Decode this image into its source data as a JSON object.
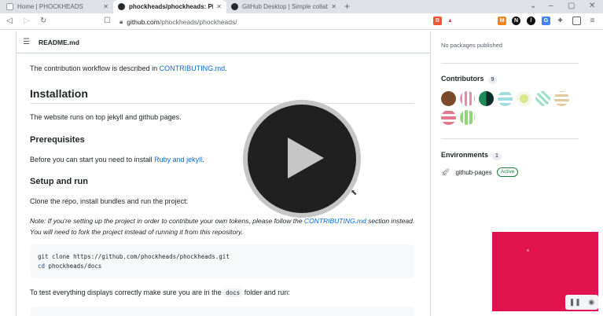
{
  "browser": {
    "tabs": [
      {
        "title": "Home | PHOCKHEADS",
        "close": "✕",
        "active": false
      },
      {
        "title": "phockheads/phockheads: Phockh",
        "close": "✕",
        "active": true
      },
      {
        "title": "GitHub Desktop | Simple collaborati",
        "close": "✕",
        "active": false
      }
    ],
    "new_tab": "+",
    "url_host": "github.com",
    "url_path": "/phockheads/phockheads/"
  },
  "readme": {
    "filename": "README.md",
    "contrib_prefix": "The contribution workflow is described in ",
    "contrib_link": "CONTRIBUTING.md",
    "contrib_suffix": ".",
    "installation_heading": "Installation",
    "installation_text": "The website runs on top jekyll and github pages.",
    "prerequisites_heading": "Prerequisites",
    "prereq_prefix": "Before you can start you need to install ",
    "prereq_link": "Ruby and jekyll",
    "prereq_suffix": ".",
    "setup_heading": "Setup and run",
    "setup_text": "Clone the repo, install bundles and run the project:",
    "note_prefix": "Note: If you're setting up the project in order to contribute your own tokens, please follow the ",
    "note_link": "CONTRIBUTING.md",
    "note_suffix": " section instead. You will need to fork the project instead of running it from this repository.",
    "code_line1_cmd": "git clone ",
    "code_line1_arg": "https://github.com/phockheads/phockheads.git",
    "code_line2_cmd": "cd",
    "code_line2_arg": " phockheads/docs",
    "test_prefix": "To test everything displays correctly make sure you are in the ",
    "test_code": "docs",
    "test_suffix": " folder and run:"
  },
  "sidebar": {
    "packages_text": "No packages published",
    "contributors_heading": "Contributors",
    "contributors_count": "9",
    "environments_heading": "Environments",
    "environments_count": "1",
    "env_name": "github-pages",
    "env_status": "Active"
  },
  "colors": {
    "link": "#0969da",
    "active_green": "#1a7f37",
    "mini_player": "#e0134f"
  }
}
